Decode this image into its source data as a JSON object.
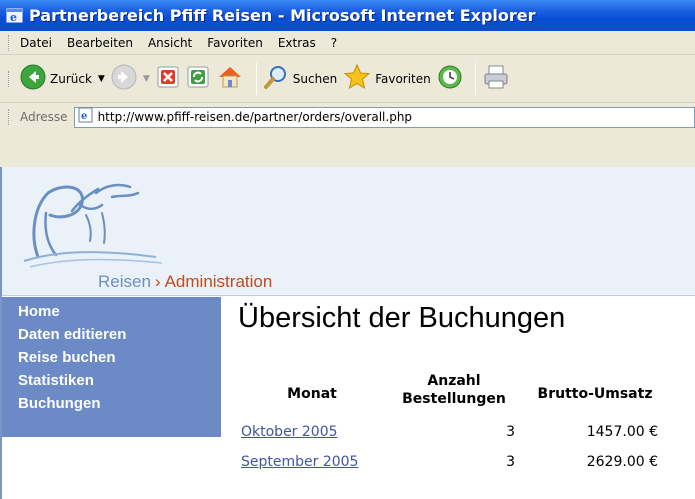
{
  "window": {
    "title": "Partnerbereich Pfiff Reisen - Microsoft Internet Explorer"
  },
  "menu": [
    "Datei",
    "Bearbeiten",
    "Ansicht",
    "Favoriten",
    "Extras",
    "?"
  ],
  "toolbar": {
    "back_label": "Zurück",
    "search_label": "Suchen",
    "favorites_label": "Favoriten"
  },
  "address": {
    "label": "Adresse",
    "url": "http://www.pfiff-reisen.de/partner/orders/overall.php"
  },
  "brand": {
    "reisen": "Reisen",
    "separator": "›",
    "section": "Administration"
  },
  "nav": [
    "Home",
    "Daten editieren",
    "Reise buchen",
    "Statistiken",
    "Buchungen"
  ],
  "page": {
    "title": "Übersicht der Buchungen"
  },
  "table": {
    "headers": {
      "month": "Monat",
      "orders_line1": "Anzahl",
      "orders_line2": "Bestellungen",
      "revenue": "Brutto-Umsatz"
    },
    "rows": [
      {
        "month": "Oktober 2005",
        "orders": "3",
        "revenue": "1457.00 €"
      },
      {
        "month": "September 2005",
        "orders": "3",
        "revenue": "2629.00 €"
      }
    ]
  },
  "colors": {
    "titlebar": "#0a4ed6",
    "sidebar": "#6b8ac6",
    "link": "#3f55a6",
    "accent": "#c24a1c"
  },
  "icons": [
    "ie-logo-icon",
    "back-arrow-icon",
    "forward-arrow-icon",
    "stop-icon",
    "refresh-icon",
    "home-icon",
    "search-icon",
    "favorites-star-icon",
    "history-icon",
    "print-icon",
    "page-icon"
  ]
}
